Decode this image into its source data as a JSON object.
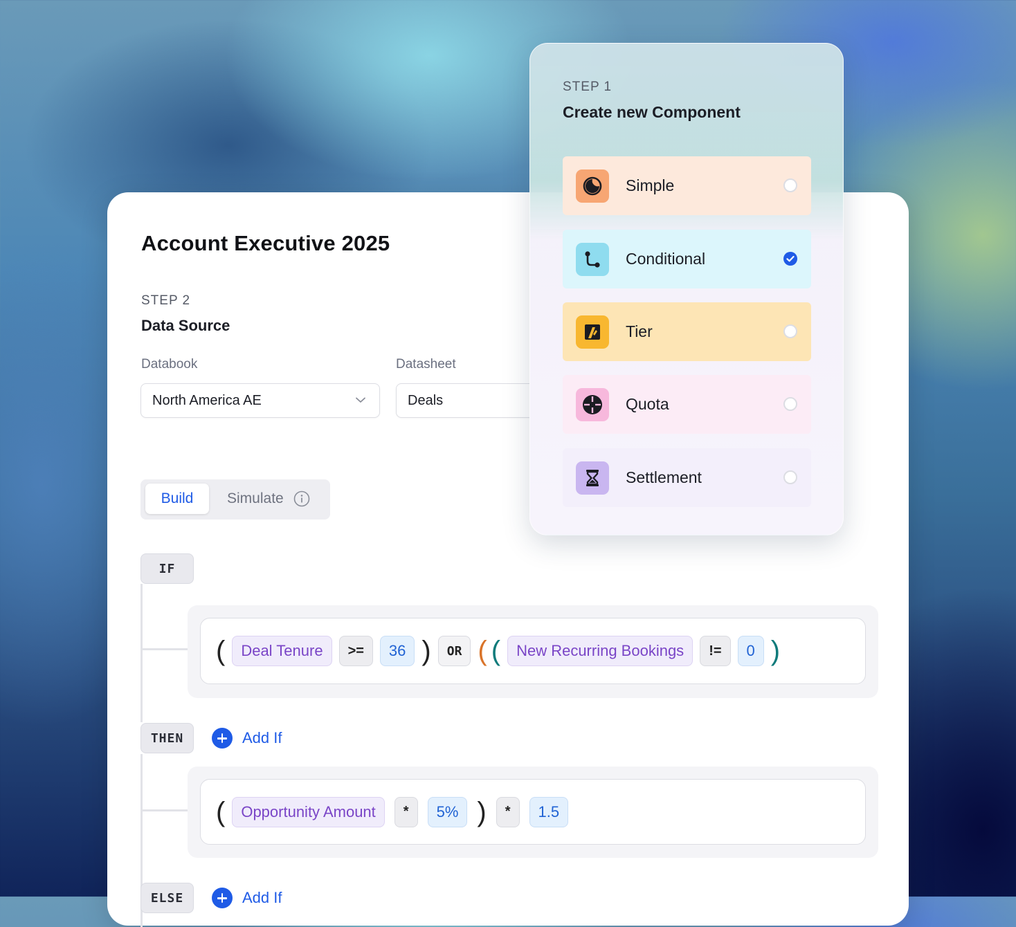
{
  "card": {
    "title": "Account Executive 2025",
    "step_label": "STEP 2",
    "step_heading": "Data Source",
    "databook_label": "Databook",
    "databook_value": "North America AE",
    "datasheet_label": "Datasheet",
    "datasheet_value": "Deals",
    "tabs": {
      "build": "Build",
      "simulate": "Simulate"
    },
    "if_kw": "IF",
    "then_kw": "THEN",
    "else_kw": "ELSE",
    "add_if": "Add If",
    "add_if_2": "Add If",
    "if_expr": {
      "open1": "(",
      "field1": "Deal Tenure",
      "op1": ">=",
      "num1": "36",
      "close1": ")",
      "or": "OR",
      "open2": "(",
      "open3": "(",
      "field2": "New Recurring Bookings",
      "op2": "!=",
      "num2": "0",
      "close3": ")"
    },
    "then_expr": {
      "open1": "(",
      "field1": "Opportunity Amount",
      "op1": "*",
      "num1": "5%",
      "close1": ")",
      "op2": "*",
      "num2": "1.5"
    }
  },
  "panel": {
    "step_label": "STEP 1",
    "heading": "Create new Component",
    "options": [
      {
        "label": "Simple",
        "selected": false,
        "icon": "half-moon-icon",
        "bg": "#fde9dc",
        "icon_bg": "#f7a673"
      },
      {
        "label": "Conditional",
        "selected": true,
        "icon": "branch-icon",
        "bg": "#dcf6fc",
        "icon_bg": "#8fdcef"
      },
      {
        "label": "Tier",
        "selected": false,
        "icon": "tier-icon",
        "bg": "#fde5b5",
        "icon_bg": "#f8b730"
      },
      {
        "label": "Quota",
        "selected": false,
        "icon": "target-icon",
        "bg": "#fcecf6",
        "icon_bg": "#f7b8dc"
      },
      {
        "label": "Settlement",
        "selected": false,
        "icon": "hourglass-icon",
        "bg": "#f3effb",
        "icon_bg": "#c9b6f0"
      }
    ]
  },
  "colors": {
    "accent": "#1f5be6",
    "field_text": "#7a45c7",
    "paren_orange": "#d9742a",
    "paren_teal": "#0f7b7b"
  }
}
